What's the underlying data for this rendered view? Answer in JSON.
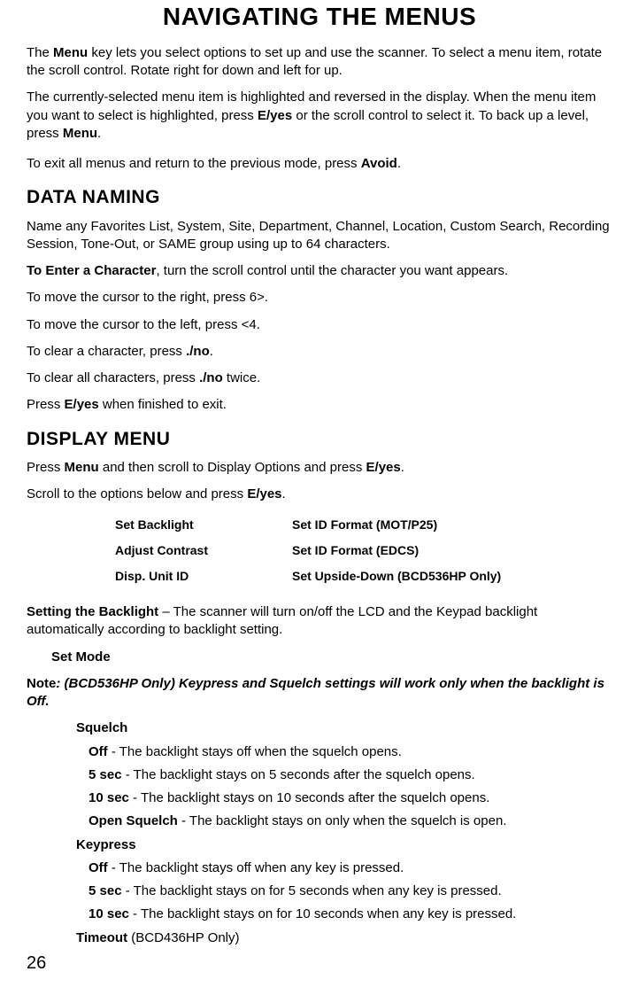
{
  "page_title": "NAVIGATING THE MENUS",
  "intro_p1_a": "The ",
  "intro_p1_b": "Menu",
  "intro_p1_c": " key lets you select options to set up and use the scanner. To select a menu item, rotate the scroll control. Rotate right for down and left for up.",
  "intro_p2_a": "The currently-selected menu item is highlighted and reversed in the display. When the menu item you want to select is highlighted, press ",
  "intro_p2_b": "E/yes",
  "intro_p2_c": " or the scroll control to select it. To back up a level, press ",
  "intro_p2_d": "Menu",
  "intro_p2_e": ".",
  "intro_p3_a": "To exit all menus and return to the previous mode, press ",
  "intro_p3_b": "Avoid",
  "intro_p3_c": ".",
  "data_naming_title": "DATA NAMING",
  "dn_p1": "Name any Favorites List, System, Site, Department, Channel, Location, Custom Search, Recording Session, Tone-Out, or SAME group using up to 64 characters.",
  "dn_p2_a": "To Enter a Character",
  "dn_p2_b": ", turn the scroll control until the character you want appears.",
  "dn_p3": "To move the cursor to the right, press 6>.",
  "dn_p4": "To move the cursor to the left, press <4.",
  "dn_p5_a": "To clear a character, press ",
  "dn_p5_b": "./no",
  "dn_p5_c": ".",
  "dn_p6_a": "To clear all characters, press ",
  "dn_p6_b": "./no",
  "dn_p6_c": " twice.",
  "dn_p7_a": "Press ",
  "dn_p7_b": "E/yes",
  "dn_p7_c": " when finished to exit.",
  "display_menu_title": "DISPLAY MENU",
  "dm_p1_a": "Press ",
  "dm_p1_b": "Menu",
  "dm_p1_c": " and then scroll to Display Options and press ",
  "dm_p1_d": "E/yes",
  "dm_p1_e": ".",
  "dm_p2_a": "Scroll to the options below and press ",
  "dm_p2_b": "E/yes",
  "dm_p2_c": ".",
  "options_left": [
    "Set Backlight",
    "Adjust Contrast",
    "Disp. Unit ID"
  ],
  "options_right": [
    "Set ID Format (MOT/P25)",
    "Set ID Format (EDCS)",
    "Set Upside-Down (BCD536HP Only)"
  ],
  "backlight_p_a": "Setting the Backlight",
  "backlight_p_b": " – The scanner will turn on/off the LCD and the Keypad backlight automatically according to backlight setting.",
  "set_mode_label": "Set Mode",
  "note_a": "Note",
  "note_b": ": (BCD536HP Only) Keypress and Squelch settings will work only when the backlight is Off.",
  "squelch_label": "Squelch",
  "squelch_items": [
    {
      "b": "Off",
      "t": " - The backlight stays off when the squelch opens."
    },
    {
      "b": "5 sec",
      "t": " - The backlight stays on 5 seconds after the squelch opens."
    },
    {
      "b": "10 sec",
      "t": " - The backlight stays on 10 seconds after the squelch opens."
    },
    {
      "b": "Open Squelch",
      "t": " - The backlight stays on only when the squelch is open."
    }
  ],
  "keypress_label": "Keypress",
  "keypress_items": [
    {
      "b": "Off",
      "t": " - The backlight stays off when any key is pressed."
    },
    {
      "b": "5 sec",
      "t": " - The backlight stays on for 5 seconds when any key is pressed."
    },
    {
      "b": "10 sec",
      "t": " - The backlight stays on for 10 seconds when any key is pressed."
    }
  ],
  "timeout_a": "Timeout",
  "timeout_b": " (BCD436HP Only)",
  "page_number": "26"
}
